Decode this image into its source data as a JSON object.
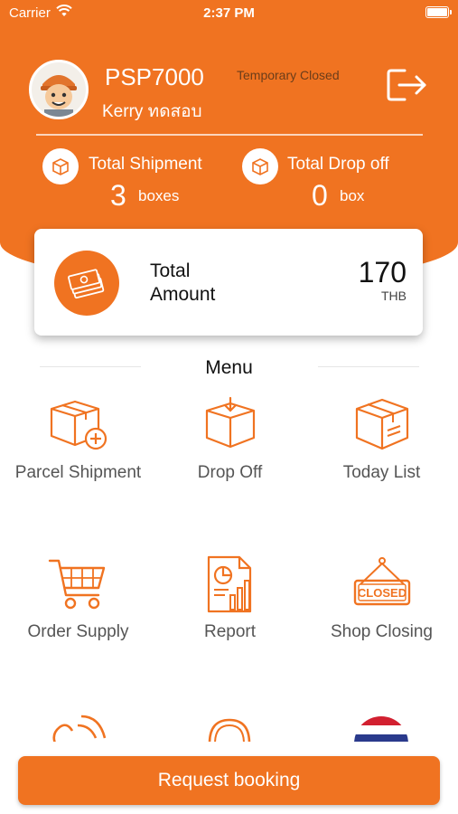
{
  "status_bar": {
    "carrier": "Carrier",
    "time": "2:37 PM"
  },
  "profile": {
    "shop_id": "PSP7000",
    "shop_name": "Kerry ทดสอบ",
    "shop_status": "Temporary Closed"
  },
  "stats": {
    "shipment": {
      "label": "Total Shipment",
      "value": "3",
      "unit": "boxes"
    },
    "dropoff": {
      "label": "Total Drop off",
      "value": "0",
      "unit": "box"
    }
  },
  "total": {
    "label": "Total Amount",
    "value": "170",
    "currency": "THB"
  },
  "menu": {
    "title": "Menu",
    "items": [
      {
        "label": "Parcel Shipment",
        "icon": "box-plus-icon"
      },
      {
        "label": "Drop Off",
        "icon": "box-dropoff-icon"
      },
      {
        "label": "Today List",
        "icon": "box-list-icon"
      },
      {
        "label": "Order Supply",
        "icon": "cart-icon"
      },
      {
        "label": "Report",
        "icon": "report-icon"
      },
      {
        "label": "Shop Closing",
        "icon": "closed-sign-icon"
      }
    ]
  },
  "request_button": "Request booking",
  "colors": {
    "brand": "#f07321",
    "white": "#ffffff",
    "text": "#555555"
  }
}
